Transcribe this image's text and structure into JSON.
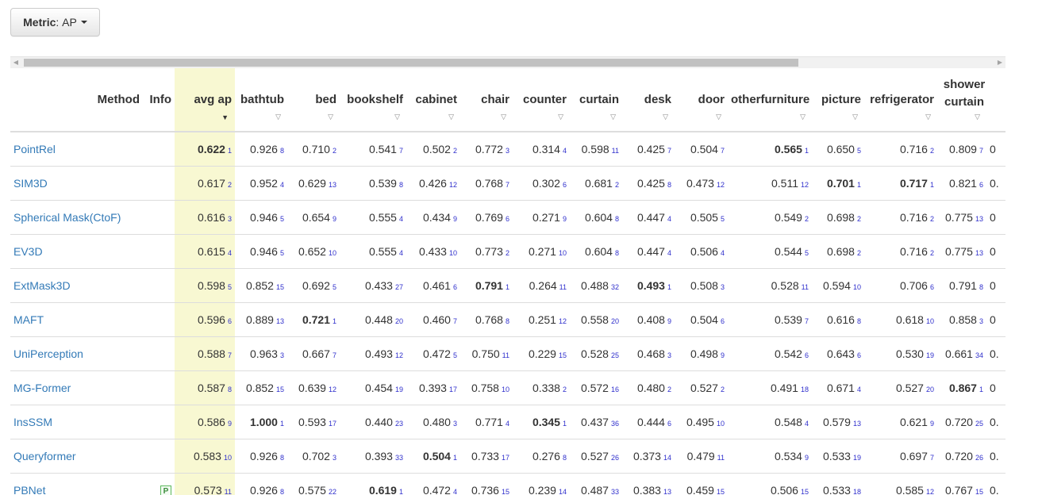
{
  "metric": {
    "label": "Metric",
    "value": "AP"
  },
  "columns": [
    "avg ap",
    "bathtub",
    "bed",
    "bookshelf",
    "cabinet",
    "chair",
    "counter",
    "curtain",
    "desk",
    "door",
    "otherfurniture",
    "picture",
    "refrigerator",
    "shower curtain"
  ],
  "header": {
    "method": "Method",
    "info": "Info",
    "cols": [
      "avg ap",
      "bathtub",
      "bed",
      "bookshelf",
      "cabinet",
      "chair",
      "counter",
      "curtain",
      "desk",
      "door",
      "otherfurniture",
      "picture",
      "refrigerator",
      "shower curtain"
    ]
  },
  "rows": [
    {
      "method": "PointRel",
      "info": "",
      "cells": [
        [
          "0.622",
          "1",
          true
        ],
        [
          "0.926",
          "8",
          false
        ],
        [
          "0.710",
          "2",
          false
        ],
        [
          "0.541",
          "7",
          false
        ],
        [
          "0.502",
          "2",
          false
        ],
        [
          "0.772",
          "3",
          false
        ],
        [
          "0.314",
          "4",
          false
        ],
        [
          "0.598",
          "11",
          false
        ],
        [
          "0.425",
          "7",
          false
        ],
        [
          "0.504",
          "7",
          false
        ],
        [
          "0.565",
          "1",
          true
        ],
        [
          "0.650",
          "5",
          false
        ],
        [
          "0.716",
          "2",
          false
        ],
        [
          "0.809",
          "7",
          false
        ]
      ],
      "trail": "0"
    },
    {
      "method": "SIM3D",
      "info": "",
      "cells": [
        [
          "0.617",
          "2",
          false
        ],
        [
          "0.952",
          "4",
          false
        ],
        [
          "0.629",
          "13",
          false
        ],
        [
          "0.539",
          "8",
          false
        ],
        [
          "0.426",
          "12",
          false
        ],
        [
          "0.768",
          "7",
          false
        ],
        [
          "0.302",
          "6",
          false
        ],
        [
          "0.681",
          "2",
          false
        ],
        [
          "0.425",
          "8",
          false
        ],
        [
          "0.473",
          "12",
          false
        ],
        [
          "0.511",
          "12",
          false
        ],
        [
          "0.701",
          "1",
          true
        ],
        [
          "0.717",
          "1",
          true
        ],
        [
          "0.821",
          "6",
          false
        ]
      ],
      "trail": "0."
    },
    {
      "method": "Spherical Mask(CtoF)",
      "info": "",
      "cells": [
        [
          "0.616",
          "3",
          false
        ],
        [
          "0.946",
          "5",
          false
        ],
        [
          "0.654",
          "9",
          false
        ],
        [
          "0.555",
          "4",
          false
        ],
        [
          "0.434",
          "9",
          false
        ],
        [
          "0.769",
          "6",
          false
        ],
        [
          "0.271",
          "9",
          false
        ],
        [
          "0.604",
          "8",
          false
        ],
        [
          "0.447",
          "4",
          false
        ],
        [
          "0.505",
          "5",
          false
        ],
        [
          "0.549",
          "2",
          false
        ],
        [
          "0.698",
          "2",
          false
        ],
        [
          "0.716",
          "2",
          false
        ],
        [
          "0.775",
          "13",
          false
        ]
      ],
      "trail": "0"
    },
    {
      "method": "EV3D",
      "info": "",
      "cells": [
        [
          "0.615",
          "4",
          false
        ],
        [
          "0.946",
          "5",
          false
        ],
        [
          "0.652",
          "10",
          false
        ],
        [
          "0.555",
          "4",
          false
        ],
        [
          "0.433",
          "10",
          false
        ],
        [
          "0.773",
          "2",
          false
        ],
        [
          "0.271",
          "10",
          false
        ],
        [
          "0.604",
          "8",
          false
        ],
        [
          "0.447",
          "4",
          false
        ],
        [
          "0.506",
          "4",
          false
        ],
        [
          "0.544",
          "5",
          false
        ],
        [
          "0.698",
          "2",
          false
        ],
        [
          "0.716",
          "2",
          false
        ],
        [
          "0.775",
          "13",
          false
        ]
      ],
      "trail": "0"
    },
    {
      "method": "ExtMask3D",
      "info": "",
      "cells": [
        [
          "0.598",
          "5",
          false
        ],
        [
          "0.852",
          "15",
          false
        ],
        [
          "0.692",
          "5",
          false
        ],
        [
          "0.433",
          "27",
          false
        ],
        [
          "0.461",
          "6",
          false
        ],
        [
          "0.791",
          "1",
          true
        ],
        [
          "0.264",
          "11",
          false
        ],
        [
          "0.488",
          "32",
          false
        ],
        [
          "0.493",
          "1",
          true
        ],
        [
          "0.508",
          "3",
          false
        ],
        [
          "0.528",
          "11",
          false
        ],
        [
          "0.594",
          "10",
          false
        ],
        [
          "0.706",
          "6",
          false
        ],
        [
          "0.791",
          "8",
          false
        ]
      ],
      "trail": "0"
    },
    {
      "method": "MAFT",
      "info": "",
      "cells": [
        [
          "0.596",
          "6",
          false
        ],
        [
          "0.889",
          "13",
          false
        ],
        [
          "0.721",
          "1",
          true
        ],
        [
          "0.448",
          "20",
          false
        ],
        [
          "0.460",
          "7",
          false
        ],
        [
          "0.768",
          "8",
          false
        ],
        [
          "0.251",
          "12",
          false
        ],
        [
          "0.558",
          "20",
          false
        ],
        [
          "0.408",
          "9",
          false
        ],
        [
          "0.504",
          "6",
          false
        ],
        [
          "0.539",
          "7",
          false
        ],
        [
          "0.616",
          "8",
          false
        ],
        [
          "0.618",
          "10",
          false
        ],
        [
          "0.858",
          "3",
          false
        ]
      ],
      "trail": "0"
    },
    {
      "method": "UniPerception",
      "info": "",
      "cells": [
        [
          "0.588",
          "7",
          false
        ],
        [
          "0.963",
          "3",
          false
        ],
        [
          "0.667",
          "7",
          false
        ],
        [
          "0.493",
          "12",
          false
        ],
        [
          "0.472",
          "5",
          false
        ],
        [
          "0.750",
          "11",
          false
        ],
        [
          "0.229",
          "15",
          false
        ],
        [
          "0.528",
          "25",
          false
        ],
        [
          "0.468",
          "3",
          false
        ],
        [
          "0.498",
          "9",
          false
        ],
        [
          "0.542",
          "6",
          false
        ],
        [
          "0.643",
          "6",
          false
        ],
        [
          "0.530",
          "19",
          false
        ],
        [
          "0.661",
          "34",
          false
        ]
      ],
      "trail": "0."
    },
    {
      "method": "MG-Former",
      "info": "",
      "cells": [
        [
          "0.587",
          "8",
          false
        ],
        [
          "0.852",
          "15",
          false
        ],
        [
          "0.639",
          "12",
          false
        ],
        [
          "0.454",
          "19",
          false
        ],
        [
          "0.393",
          "17",
          false
        ],
        [
          "0.758",
          "10",
          false
        ],
        [
          "0.338",
          "2",
          false
        ],
        [
          "0.572",
          "16",
          false
        ],
        [
          "0.480",
          "2",
          false
        ],
        [
          "0.527",
          "2",
          false
        ],
        [
          "0.491",
          "18",
          false
        ],
        [
          "0.671",
          "4",
          false
        ],
        [
          "0.527",
          "20",
          false
        ],
        [
          "0.867",
          "1",
          true
        ]
      ],
      "trail": "0"
    },
    {
      "method": "InsSSM",
      "info": "",
      "cells": [
        [
          "0.586",
          "9",
          false
        ],
        [
          "1.000",
          "1",
          true
        ],
        [
          "0.593",
          "17",
          false
        ],
        [
          "0.440",
          "23",
          false
        ],
        [
          "0.480",
          "3",
          false
        ],
        [
          "0.771",
          "4",
          false
        ],
        [
          "0.345",
          "1",
          true
        ],
        [
          "0.437",
          "36",
          false
        ],
        [
          "0.444",
          "6",
          false
        ],
        [
          "0.495",
          "10",
          false
        ],
        [
          "0.548",
          "4",
          false
        ],
        [
          "0.579",
          "13",
          false
        ],
        [
          "0.621",
          "9",
          false
        ],
        [
          "0.720",
          "25",
          false
        ]
      ],
      "trail": "0."
    },
    {
      "method": "Queryformer",
      "info": "",
      "cells": [
        [
          "0.583",
          "10",
          false
        ],
        [
          "0.926",
          "8",
          false
        ],
        [
          "0.702",
          "3",
          false
        ],
        [
          "0.393",
          "33",
          false
        ],
        [
          "0.504",
          "1",
          true
        ],
        [
          "0.733",
          "17",
          false
        ],
        [
          "0.276",
          "8",
          false
        ],
        [
          "0.527",
          "26",
          false
        ],
        [
          "0.373",
          "14",
          false
        ],
        [
          "0.479",
          "11",
          false
        ],
        [
          "0.534",
          "9",
          false
        ],
        [
          "0.533",
          "19",
          false
        ],
        [
          "0.697",
          "7",
          false
        ],
        [
          "0.720",
          "26",
          false
        ]
      ],
      "trail": "0."
    },
    {
      "method": "PBNet",
      "info": "P",
      "cells": [
        [
          "0.573",
          "11",
          false
        ],
        [
          "0.926",
          "8",
          false
        ],
        [
          "0.575",
          "22",
          false
        ],
        [
          "0.619",
          "1",
          true
        ],
        [
          "0.472",
          "4",
          false
        ],
        [
          "0.736",
          "15",
          false
        ],
        [
          "0.239",
          "14",
          false
        ],
        [
          "0.487",
          "33",
          false
        ],
        [
          "0.383",
          "13",
          false
        ],
        [
          "0.459",
          "15",
          false
        ],
        [
          "0.506",
          "15",
          false
        ],
        [
          "0.533",
          "18",
          false
        ],
        [
          "0.585",
          "12",
          false
        ],
        [
          "0.767",
          "15",
          false
        ]
      ],
      "trail": "0."
    }
  ]
}
